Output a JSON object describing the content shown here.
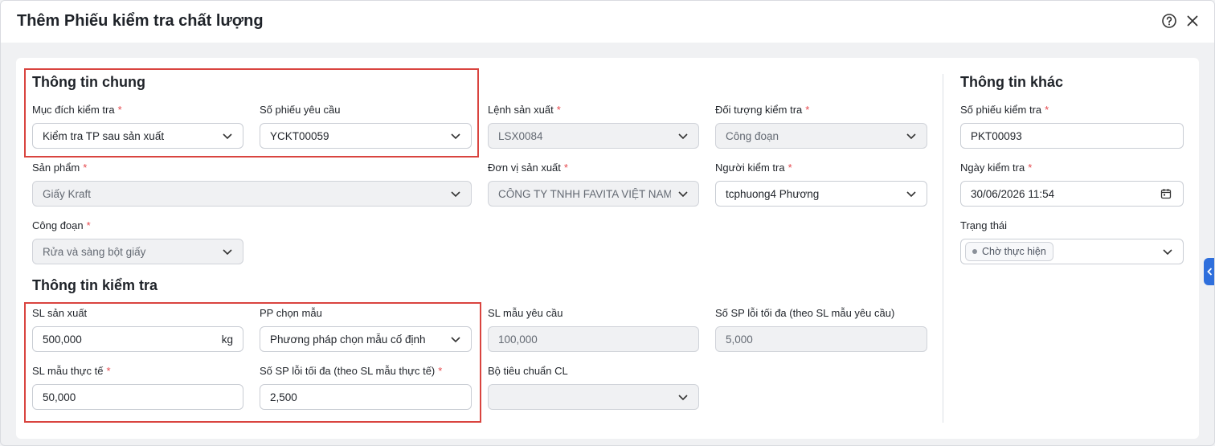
{
  "dialog": {
    "title": "Thêm Phiếu kiểm tra chất lượng",
    "help_icon": "help-circle-icon",
    "close_icon": "close-icon"
  },
  "general": {
    "title": "Thông tin chung",
    "muc_dich": {
      "label": "Mục đích kiểm tra",
      "value": "Kiểm tra TP sau sản xuất"
    },
    "so_phieu_yc": {
      "label": "Số phiếu yêu cầu",
      "value": "YCKT00059"
    },
    "lenh_sx": {
      "label": "Lệnh sản xuất",
      "value": "LSX0084"
    },
    "doi_tuong": {
      "label": "Đối tượng kiểm tra",
      "value": "Công đoạn"
    },
    "san_pham": {
      "label": "Sản phẩm",
      "value": "Giấy Kraft"
    },
    "don_vi": {
      "label": "Đơn vị sản xuất",
      "value": "CÔNG TY TNHH FAVITA VIỆT NAM"
    },
    "nguoi_kt": {
      "label": "Người kiểm tra",
      "value": "tcphuong4 Phương"
    },
    "cong_doan": {
      "label": "Công đoạn",
      "value": "Rửa và sàng bột giấy"
    }
  },
  "inspection": {
    "title": "Thông tin kiểm tra",
    "sl_sx": {
      "label": "SL sản xuất",
      "value": "500,000",
      "unit": "kg"
    },
    "pp_chon": {
      "label": "PP chọn mẫu",
      "value": "Phương pháp chọn mẫu cố định"
    },
    "sl_mau_yc": {
      "label": "SL mẫu yêu cầu",
      "value": "100,000"
    },
    "loi_max_yc": {
      "label": "Số SP lỗi tối đa (theo SL mẫu yêu cầu)",
      "value": "5,000"
    },
    "sl_mau_tt": {
      "label": "SL mẫu thực tế",
      "value": "50,000"
    },
    "loi_max_tt": {
      "label": "Số SP lỗi tối đa (theo SL mẫu thực tế)",
      "value": "2,500"
    },
    "bo_tieu_chuan": {
      "label": "Bộ tiêu chuẩn CL",
      "value": ""
    }
  },
  "other": {
    "title": "Thông tin khác",
    "so_phieu_kt": {
      "label": "Số phiếu kiểm tra",
      "value": "PKT00093"
    },
    "ngay_kt": {
      "label": "Ngày kiểm tra",
      "value": "30/06/2026 11:54"
    },
    "trang_thai": {
      "label": "Trạng thái",
      "value": "Chờ thực hiện"
    }
  },
  "colors": {
    "accent": "#2f6fdc",
    "required": "#e5484d",
    "highlight_box": "#d9443f"
  }
}
